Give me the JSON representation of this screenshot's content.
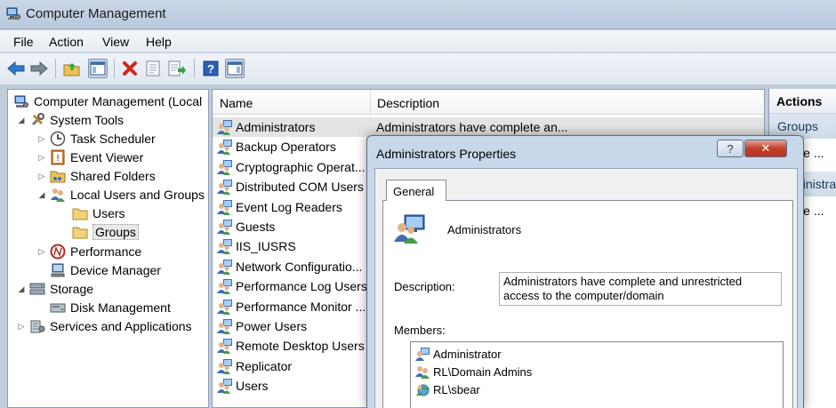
{
  "window": {
    "title": "Computer Management"
  },
  "menu": [
    "File",
    "Action",
    "View",
    "Help"
  ],
  "toolbar": {
    "icons": [
      "back-arrow-icon",
      "forward-arrow-icon",
      "up-folder-icon",
      "show-hide-tree-icon",
      "delete-icon",
      "properties-icon",
      "export-list-icon",
      "help-icon",
      "show-hide-action-pane-icon"
    ]
  },
  "tree": {
    "root": "Computer Management (Local",
    "system_tools": "System Tools",
    "task_scheduler": "Task Scheduler",
    "event_viewer": "Event Viewer",
    "shared_folders": "Shared Folders",
    "local_users_groups": "Local Users and Groups",
    "users": "Users",
    "groups": "Groups",
    "performance": "Performance",
    "device_manager": "Device Manager",
    "storage": "Storage",
    "disk_management": "Disk Management",
    "services_apps": "Services and Applications"
  },
  "list": {
    "columns": [
      "Name",
      "Description"
    ],
    "rows": [
      {
        "name": "Administrators",
        "description": "Administrators have complete an..."
      },
      {
        "name": "Backup Operators",
        "description": ""
      },
      {
        "name": "Cryptographic Operat...",
        "description": ""
      },
      {
        "name": "Distributed COM Users",
        "description": ""
      },
      {
        "name": "Event Log Readers",
        "description": ""
      },
      {
        "name": "Guests",
        "description": ""
      },
      {
        "name": "IIS_IUSRS",
        "description": ""
      },
      {
        "name": "Network Configuratio...",
        "description": ""
      },
      {
        "name": "Performance Log Users",
        "description": ""
      },
      {
        "name": "Performance Monitor ...",
        "description": ""
      },
      {
        "name": "Power Users",
        "description": ""
      },
      {
        "name": "Remote Desktop Users",
        "description": ""
      },
      {
        "name": "Replicator",
        "description": ""
      },
      {
        "name": "Users",
        "description": ""
      }
    ]
  },
  "actions": {
    "header": "Actions",
    "group1": "Groups",
    "more1": "More ...",
    "group2": "Administrators",
    "more2": "More ..."
  },
  "dialog": {
    "title": "Administrators Properties",
    "help_btn": "?",
    "close_btn": "✕",
    "tab_general": "General",
    "group_name": "Administrators",
    "description_label": "Description:",
    "description_value": "Administrators have complete and unrestricted access to the computer/domain",
    "members_label": "Members:",
    "members": [
      "Administrator",
      "RL\\Domain Admins",
      "RL\\sbear"
    ]
  }
}
